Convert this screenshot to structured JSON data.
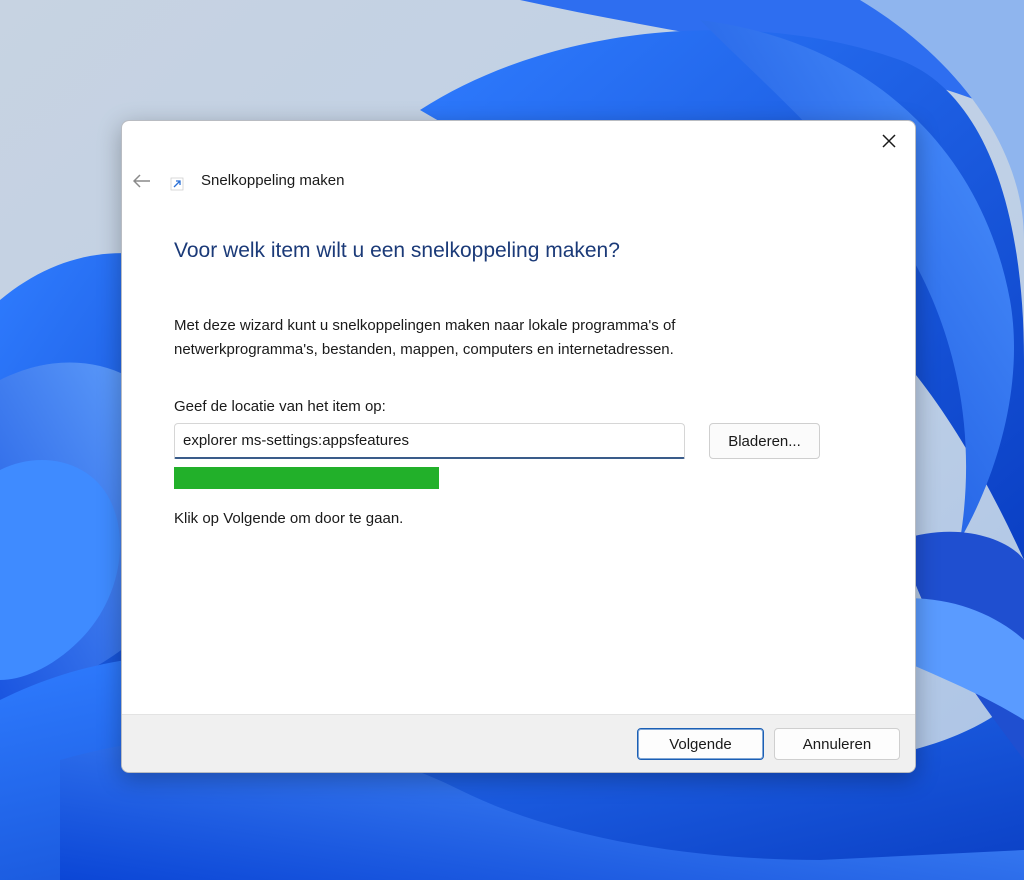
{
  "window": {
    "title": "Snelkoppeling maken",
    "close_icon": "close-icon",
    "back_icon": "back-arrow-icon",
    "app_icon": "shortcut-arrow-icon"
  },
  "wizard": {
    "heading": "Voor welk item wilt u een snelkoppeling maken?",
    "description": "Met deze wizard kunt u snelkoppelingen maken naar lokale programma's of netwerkprogramma's, bestanden, mappen, computers en internetadressen.",
    "location_label": "Geef de locatie van het item op:",
    "location_value": "explorer ms-settings:appsfeatures",
    "browse_label": "Bladeren...",
    "progress": 1.0,
    "hint": "Klik op Volgende om door te gaan."
  },
  "footer": {
    "next_label": "Volgende",
    "cancel_label": "Annuleren"
  },
  "colors": {
    "heading": "#1b3a78",
    "progress_fill": "#22b02a",
    "wallpaper_blue": "#1d5fe6"
  }
}
